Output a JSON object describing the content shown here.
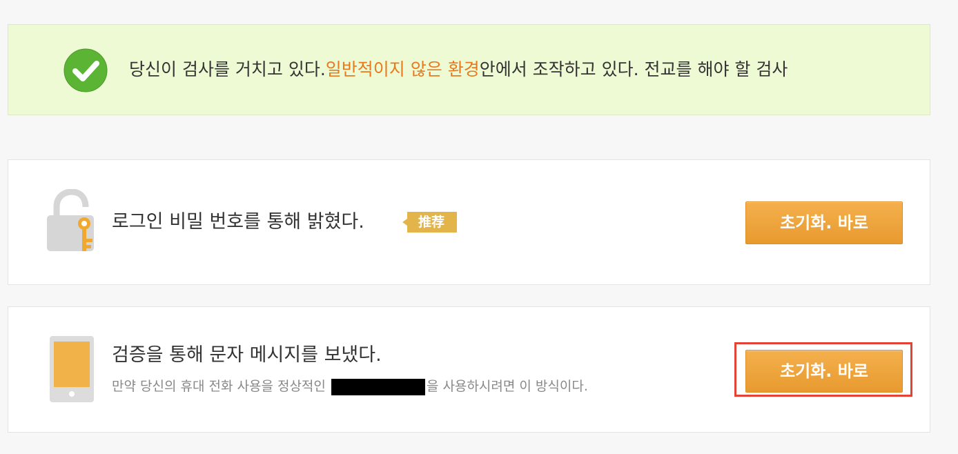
{
  "notice": {
    "text_before": "당신이 검사를 거치고 있다.",
    "text_highlight": "일반적이지 않은 환경",
    "text_after": "안에서 조작하고 있다. 전교를 해야 할 검사",
    "highlight_color": "#e87a1e",
    "icon": "check-circle-icon"
  },
  "methods": [
    {
      "title": "로그인 비밀 번호를 통해 밝혔다.",
      "badge": "推荐",
      "icon": "lock-key-icon",
      "button_label": "초기화. 바로"
    },
    {
      "title": "검증을 통해 문자 메시지를 보냈다.",
      "subtitle_before": "만약 당신의 휴대 전화 사용을 정상적인",
      "subtitle_after": "을 사용하시려면 이 방식이다.",
      "icon": "phone-icon",
      "button_label": "초기화. 바로"
    }
  ],
  "colors": {
    "accent_orange": "#e89a2f",
    "notice_bg": "#eefad4",
    "success_green": "#5bb434",
    "focus_red": "#e34234"
  }
}
